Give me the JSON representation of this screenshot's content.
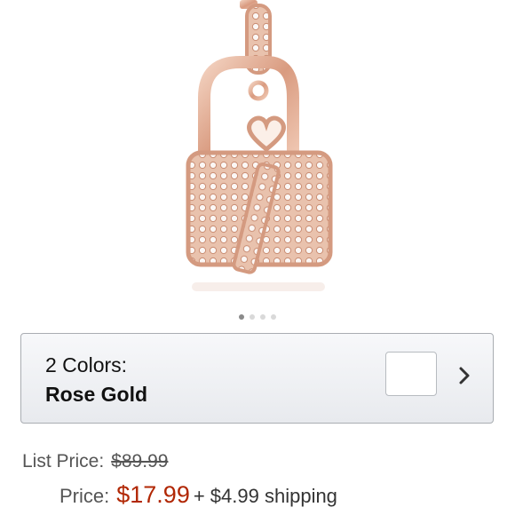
{
  "gallery": {
    "image_name": "rose gold padlock and key pendant",
    "dot_count": 4,
    "active_index": 0
  },
  "color_selector": {
    "count_label": "2 Colors:",
    "selected": "Rose Gold",
    "swatch_color": "#ffffff"
  },
  "pricing": {
    "list_label": "List Price:",
    "list_value": "$89.99",
    "price_label": "Price:",
    "price_value": "$17.99",
    "shipping": "+ $4.99 shipping"
  },
  "colors": {
    "price": "#b12704",
    "rose_gold": "#e3b59c"
  }
}
